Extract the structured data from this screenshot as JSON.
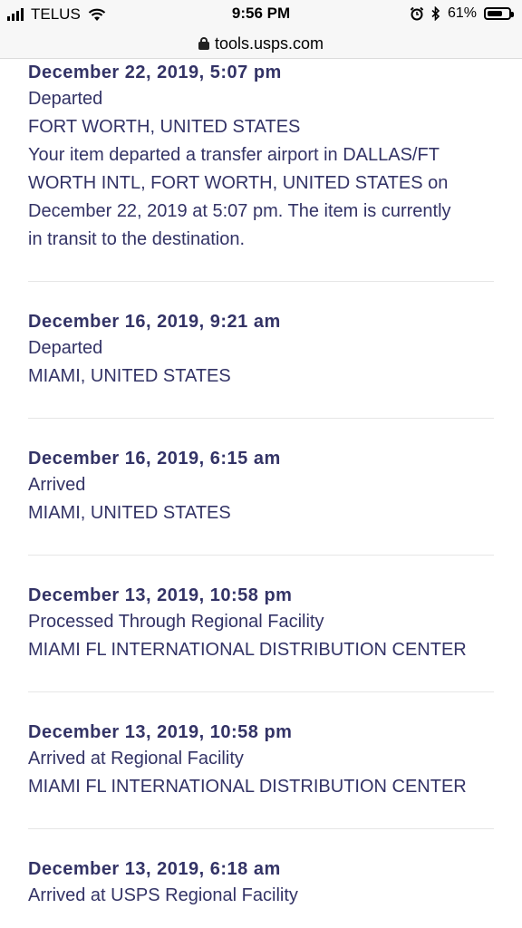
{
  "status_bar": {
    "carrier": "TELUS",
    "time": "9:56 PM",
    "battery": "61%"
  },
  "url_bar": {
    "url": "tools.usps.com"
  },
  "events": [
    {
      "date": "December 22, 2019, 5:07 pm",
      "status": "Departed",
      "location": "FORT WORTH, UNITED STATES",
      "details": [
        "Your item departed a transfer airport in DALLAS/FT",
        "WORTH INTL, FORT WORTH, UNITED STATES on",
        "December 22, 2019 at 5:07 pm. The item is currently",
        "in transit to the destination."
      ]
    },
    {
      "date": "December 16, 2019, 9:21 am",
      "status": "Departed",
      "location": "MIAMI, UNITED STATES"
    },
    {
      "date": "December 16, 2019, 6:15 am",
      "status": "Arrived",
      "location": "MIAMI, UNITED STATES"
    },
    {
      "date": "December 13, 2019, 10:58 pm",
      "status": "Processed Through Regional Facility",
      "location": "MIAMI FL INTERNATIONAL DISTRIBUTION CENTER"
    },
    {
      "date": "December 13, 2019, 10:58 pm",
      "status": "Arrived at Regional Facility",
      "location": "MIAMI FL INTERNATIONAL DISTRIBUTION CENTER"
    },
    {
      "date": "December 13, 2019, 6:18 am",
      "status": "Arrived at USPS Regional Facility"
    }
  ]
}
